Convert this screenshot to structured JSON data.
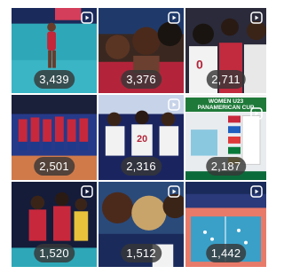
{
  "grid": {
    "tiles": [
      {
        "views": "3,439",
        "scene": "player-serve"
      },
      {
        "views": "3,376",
        "scene": "team-huddle"
      },
      {
        "views": "2,711",
        "scene": "players-jerseys"
      },
      {
        "views": "2,501",
        "scene": "team-lineup"
      },
      {
        "views": "2,316",
        "scene": "bench-players"
      },
      {
        "views": "2,187",
        "scene": "scoreboard",
        "caption": "WOMEN U23 PANAMERICAN CUP"
      },
      {
        "views": "1,520",
        "scene": "players-red"
      },
      {
        "views": "1,512",
        "scene": "huddle-closeup"
      },
      {
        "views": "1,442",
        "scene": "court-wide"
      }
    ]
  },
  "icons": {
    "reel": "reel-icon"
  },
  "colors": {
    "badge_bg": "#373737",
    "badge_text": "#ffffff"
  }
}
